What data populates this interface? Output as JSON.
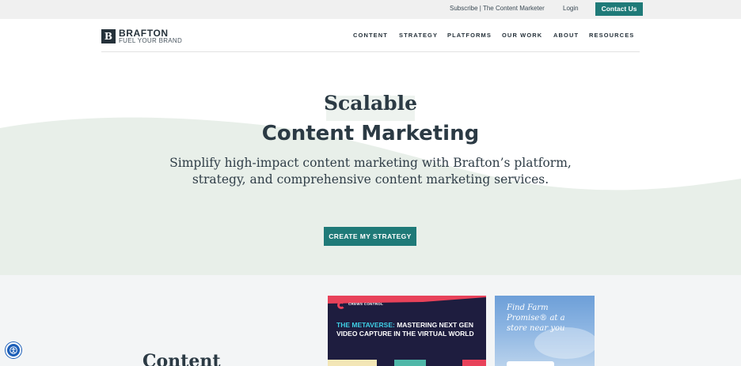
{
  "utility_bar": {
    "subscribe_label": "Subscribe | The Content Marketer",
    "login_label": "Login",
    "contact_label": "Contact Us"
  },
  "header": {
    "logo_mark": "B",
    "logo_name": "BRAFTON",
    "logo_tagline": "FUEL YOUR BRAND",
    "nav": [
      "CONTENT",
      "STRATEGY",
      "PLATFORMS",
      "OUR WORK",
      "ABOUT",
      "RESOURCES"
    ]
  },
  "hero": {
    "eyebrow": "Scalable",
    "title": "Content Marketing",
    "subtitle": "Simplify high-impact content marketing with Brafton’s platform, strategy, and comprehensive content marketing services.",
    "cta_label": "CREATE MY STRATEGY"
  },
  "lower": {
    "heading": "Content",
    "card_crews": {
      "logo_text": "CREWS CONTROL",
      "headline_accent": "THE METAVERSE:",
      "headline_rest": " MASTERING NEXT GEN VIDEO CAPTURE IN THE VIRTUAL WORLD"
    },
    "card_farm": {
      "text": "Find Farm Promise® at a store near you"
    }
  },
  "colors": {
    "brand_teal": "#1f7a78",
    "hero_wave": "#e8efe9",
    "dark_text": "#2b3a44",
    "crews_navy": "#1e1d3f",
    "crews_red": "#e8425a",
    "crews_cyan": "#3fd0e6"
  },
  "icons": {
    "accessibility": "accessibility-icon"
  }
}
